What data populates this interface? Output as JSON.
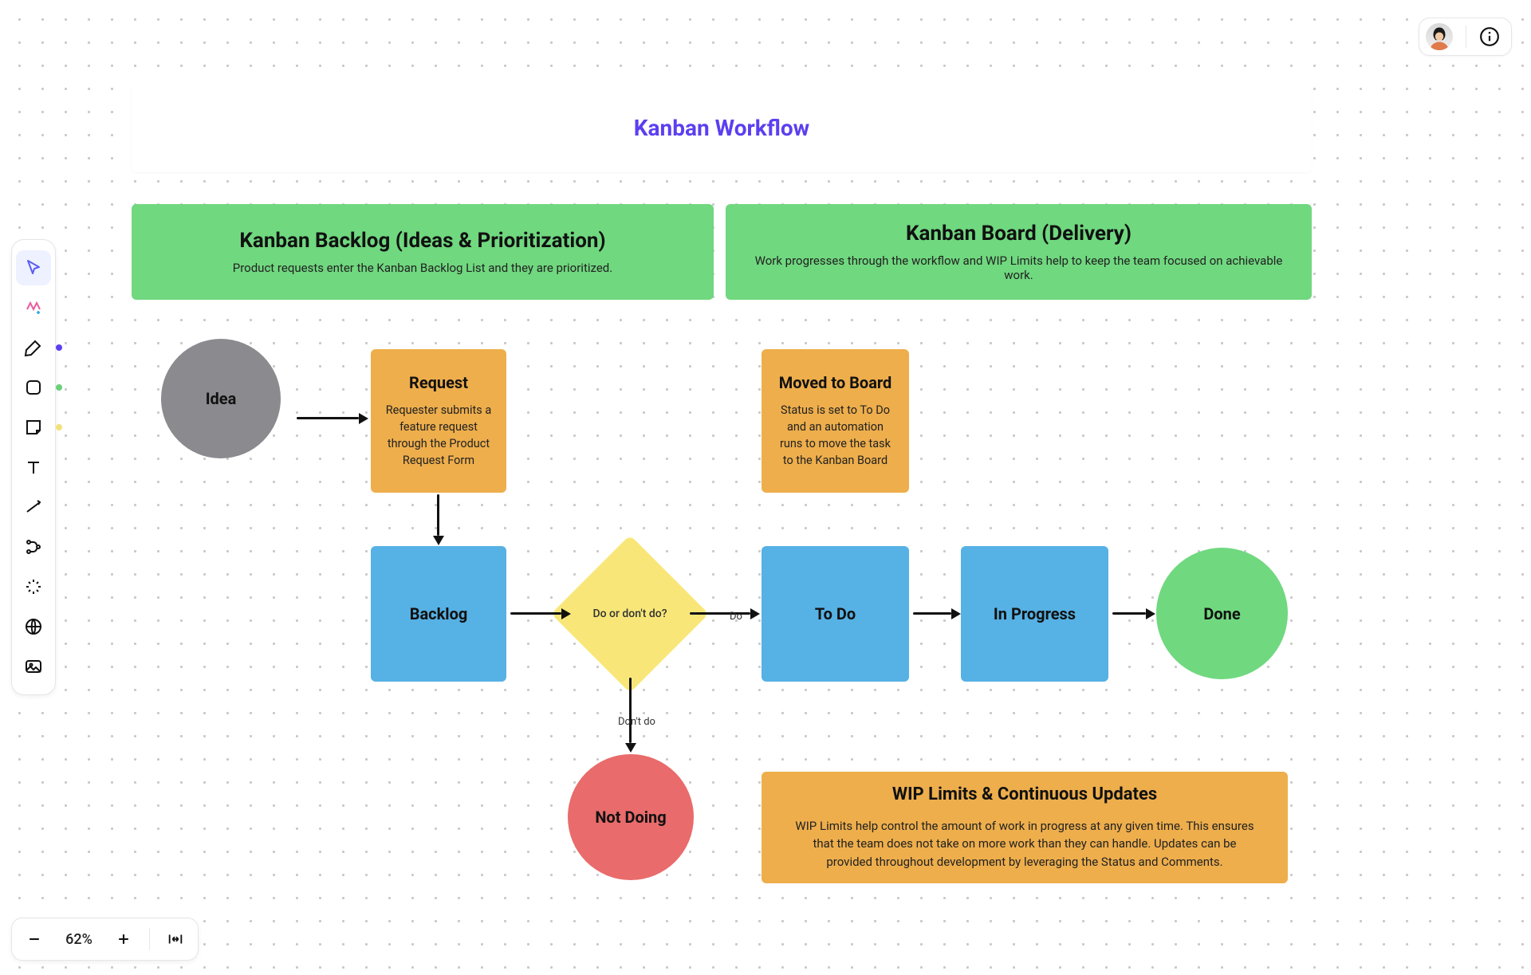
{
  "zoom": {
    "level": "62%"
  },
  "toolbar": {
    "dots": {
      "pen": "#5b3ff0",
      "shape": "#6ad07a",
      "sticky": "#f4e07a"
    }
  },
  "diagram": {
    "title": "Kanban Workflow",
    "sections": [
      {
        "title": "Kanban Backlog (Ideas & Prioritization)",
        "subtitle": "Product requests enter the Kanban Backlog List and they are prioritized."
      },
      {
        "title": "Kanban Board (Delivery)",
        "subtitle": "Work progresses through the workflow and WIP Limits help to keep the team focused on achievable work."
      }
    ],
    "idea": "Idea",
    "request": {
      "title": "Request",
      "body": "Requester submits a feature request through the Product Request Form"
    },
    "movedToBoard": {
      "title": "Moved to Board",
      "body": "Status is set to To Do and an automation runs to move the task to the Kanban Board"
    },
    "backlog": "Backlog",
    "decision": "Do or don't do?",
    "decisionDo": "Do",
    "decisionDont": "Don't do",
    "todo": "To Do",
    "inProgress": "In Progress",
    "done": "Done",
    "notDoing": "Not Doing",
    "wip": {
      "title": "WIP Limits & Continuous Updates",
      "body": "WIP Limits help control the amount of work in progress at any given time. This ensures that the team does not take on more work than they can handle. Updates can be provided throughout development by leveraging the Status and Comments."
    }
  }
}
